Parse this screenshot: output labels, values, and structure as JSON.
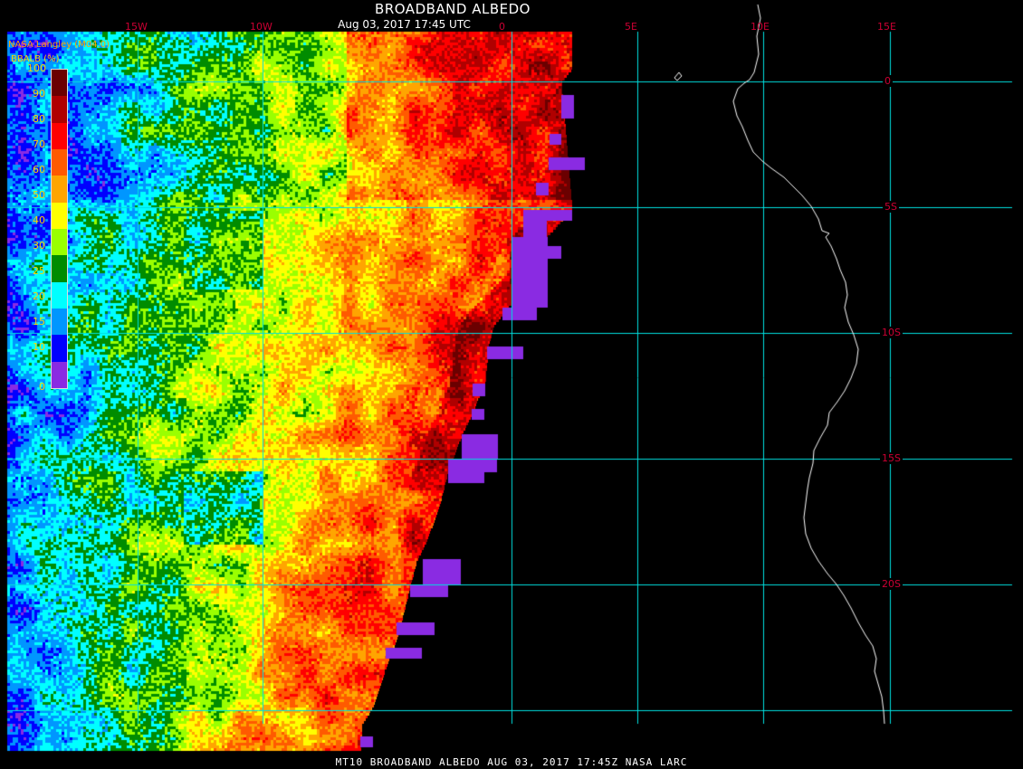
{
  "header": {
    "title": "BROADBAND ALBEDO",
    "subtitle": "Aug 03, 2017 17:45 UTC",
    "credit": "NASA Langley (M04.0)"
  },
  "footer": {
    "caption": "MT10  BROADBAND ALBEDO   AUG 03, 2017 17:45Z   NASA LARC"
  },
  "legend": {
    "title": "BBALB (%)",
    "labels": [
      "100",
      "90",
      "80",
      "70",
      "60",
      "50",
      "40",
      "30",
      "25",
      "20",
      "15",
      "10",
      "0"
    ],
    "colors_top_to_bottom": [
      "#6b0000",
      "#b00000",
      "#ff0000",
      "#ff5a00",
      "#ffa500",
      "#ffff00",
      "#9aff00",
      "#008c00",
      "#00ffff",
      "#0096ff",
      "#0000ff",
      "#8a2be2"
    ]
  },
  "grid": {
    "longitude_labels": [
      "15W",
      "10W",
      "0",
      "5E",
      "10E",
      "15E"
    ],
    "latitude_labels": [
      "0",
      "5S",
      "10S",
      "15S",
      "20S"
    ],
    "line_color": "#00e0e0",
    "label_color": "#cc0033"
  },
  "map": {
    "background": "#000000",
    "coastline_color": "#ffffff"
  }
}
